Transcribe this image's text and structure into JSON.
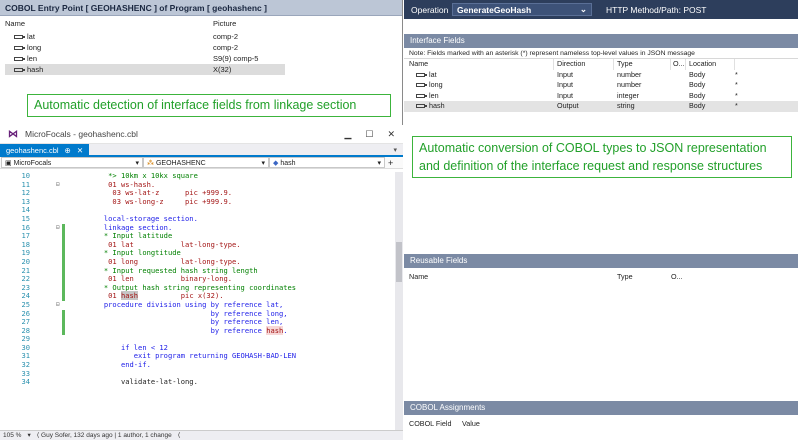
{
  "left_pane": {
    "title": "COBOL Entry Point [ GEOHASHENC ] of Program [ geohashenc ]",
    "columns": [
      "Name",
      "Picture"
    ],
    "fields": [
      {
        "name": "lat",
        "picture": "comp-2"
      },
      {
        "name": "long",
        "picture": "comp-2"
      },
      {
        "name": "len",
        "picture": "S9(9) comp-5"
      },
      {
        "name": "hash",
        "picture": "X(32)"
      }
    ],
    "callout": "Automatic detection of interface fields from linkage section"
  },
  "ide": {
    "window_title": "MicroFocals - geohashenc.cbl",
    "tab_label": "geohashenc.cbl",
    "tab_pin": "⊕",
    "tab_close": "✕",
    "project": "MicroFocals",
    "scope": "GEOHASHENC",
    "member": "hash",
    "lines": [
      {
        "n": "10",
        "t": "        *> 10km x 10kx square",
        "cls": "cm"
      },
      {
        "n": "11",
        "t": "        01 ws-hash.",
        "cls": "v"
      },
      {
        "n": "12",
        "t": "         03 ws-lat-z      pic +999.9.",
        "cls": "v"
      },
      {
        "n": "13",
        "t": "         03 ws-long-z     pic +999.9.",
        "cls": "v"
      },
      {
        "n": "14",
        "t": "",
        "cls": "ct"
      },
      {
        "n": "15",
        "t": "       local-storage section.",
        "cls": "k"
      },
      {
        "n": "16",
        "t": "       linkage section.",
        "cls": "k"
      },
      {
        "n": "17",
        "t": "       * Input latitude",
        "cls": "cm"
      },
      {
        "n": "18",
        "t": "        01 lat           lat-long-type.",
        "cls": "v"
      },
      {
        "n": "19",
        "t": "       * Input longtitude",
        "cls": "cm"
      },
      {
        "n": "20",
        "t": "        01 long          lat-long-type.",
        "cls": "v"
      },
      {
        "n": "21",
        "t": "       * Input requested hash string length",
        "cls": "cm"
      },
      {
        "n": "22",
        "t": "        01 len           binary-long.",
        "cls": "v"
      },
      {
        "n": "23",
        "t": "       * Output hash string representing coordinates",
        "cls": "cm"
      },
      {
        "n": "24",
        "t": "        01 hash          pic x(32).",
        "cls": "v"
      },
      {
        "n": "25",
        "t": "       procedure division using by reference lat,",
        "cls": "k"
      },
      {
        "n": "26",
        "t": "                                by reference long,",
        "cls": "k"
      },
      {
        "n": "27",
        "t": "                                by reference len,",
        "cls": "k"
      },
      {
        "n": "28",
        "t": "                                by reference hash.",
        "cls": "k"
      },
      {
        "n": "29",
        "t": "",
        "cls": "ct"
      },
      {
        "n": "30",
        "t": "           if len < 12",
        "cls": "k"
      },
      {
        "n": "31",
        "t": "              exit program returning GEOHASH-BAD-LEN",
        "cls": "k"
      },
      {
        "n": "32",
        "t": "           end-if.",
        "cls": "k"
      },
      {
        "n": "33",
        "t": "",
        "cls": "ct"
      },
      {
        "n": "34",
        "t": "           validate-lat-long.",
        "cls": "d"
      }
    ],
    "status": [
      "105 %",
      "▾",
      "⟨ Guy Sofer, 132 days ago | 1 author, 1 change",
      "⟨"
    ]
  },
  "right_pane": {
    "operation_label": "Operation",
    "operation_value": "GenerateGeoHash",
    "http_label": "HTTP Method/Path: POST",
    "interface_title": "Interface Fields",
    "note": "Note: Fields marked with an asterisk (*) represent nameless top-level values in JSON message",
    "columns": [
      "Name",
      "Direction",
      "Type",
      "O...",
      "Location"
    ],
    "fields": [
      {
        "name": "lat",
        "direction": "Input",
        "type": "number",
        "location": "Body",
        "star": "*"
      },
      {
        "name": "long",
        "direction": "Input",
        "type": "number",
        "location": "Body",
        "star": "*"
      },
      {
        "name": "len",
        "direction": "Input",
        "type": "integer",
        "location": "Body",
        "star": "*"
      },
      {
        "name": "hash",
        "direction": "Output",
        "type": "string",
        "location": "Body",
        "star": "*"
      }
    ],
    "callout": "Automatic conversion of COBOL types to JSON representation and definition of the interface request and response structures",
    "reusable_title": "Reusable Fields",
    "reusable_columns": [
      "Name",
      "Type",
      "O..."
    ],
    "assign_title": "COBOL Assignments",
    "assign_columns": [
      "COBOL Field",
      "Value"
    ]
  },
  "colors": {
    "accent": "#007acc",
    "callout_green": "#22a02a",
    "header_navy": "#2d3e5c"
  }
}
